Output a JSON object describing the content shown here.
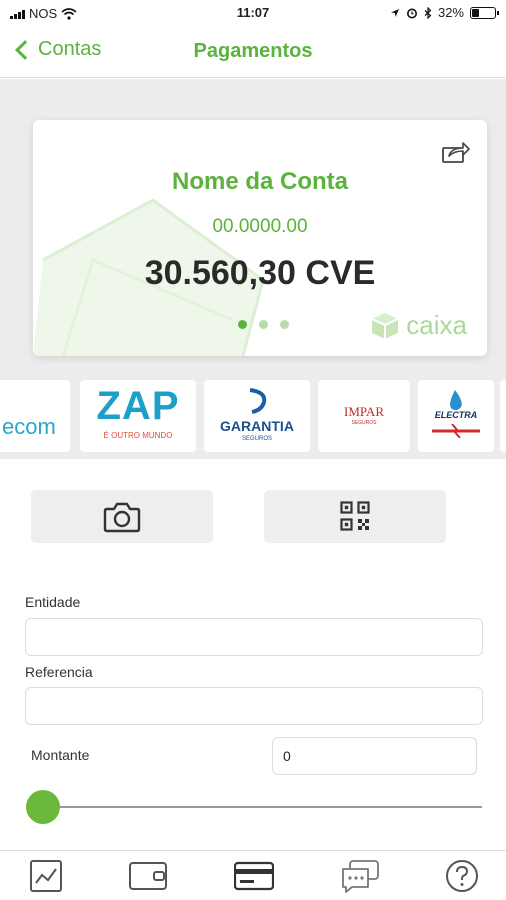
{
  "status_bar": {
    "carrier": "NOS",
    "time": "11:07",
    "battery": "32%",
    "battery_level": 0.32
  },
  "nav": {
    "back_label": "Contas",
    "title": "Pagamentos"
  },
  "card": {
    "name": "Nome da Conta",
    "number": "00.0000.00",
    "balance": "30.560,30 CVE",
    "brand": "caixa",
    "page_count": 3,
    "active_page": 1
  },
  "merchants": [
    {
      "text": "ecom"
    },
    {
      "text": "ZAP",
      "tagline": "É OUTRO MUNDO"
    },
    {
      "text": "GARANTIA",
      "tagline": "SEGUROS"
    },
    {
      "text": "IMPAR",
      "tagline": "SEGUROS"
    },
    {
      "text": "ELECTRA"
    }
  ],
  "form": {
    "entidade_label": "Entidade",
    "entidade_value": "",
    "referencia_label": "Referencia",
    "referencia_value": "",
    "montante_label": "Montante",
    "montante_value": "0",
    "slider_value": 0
  },
  "tabs": [
    "chart-icon",
    "wallet-icon",
    "card-icon",
    "chat-icon",
    "help-icon"
  ],
  "colors": {
    "accent": "#5bb33d",
    "accent_light": "#a9d99a",
    "background_gray": "#ececec"
  }
}
